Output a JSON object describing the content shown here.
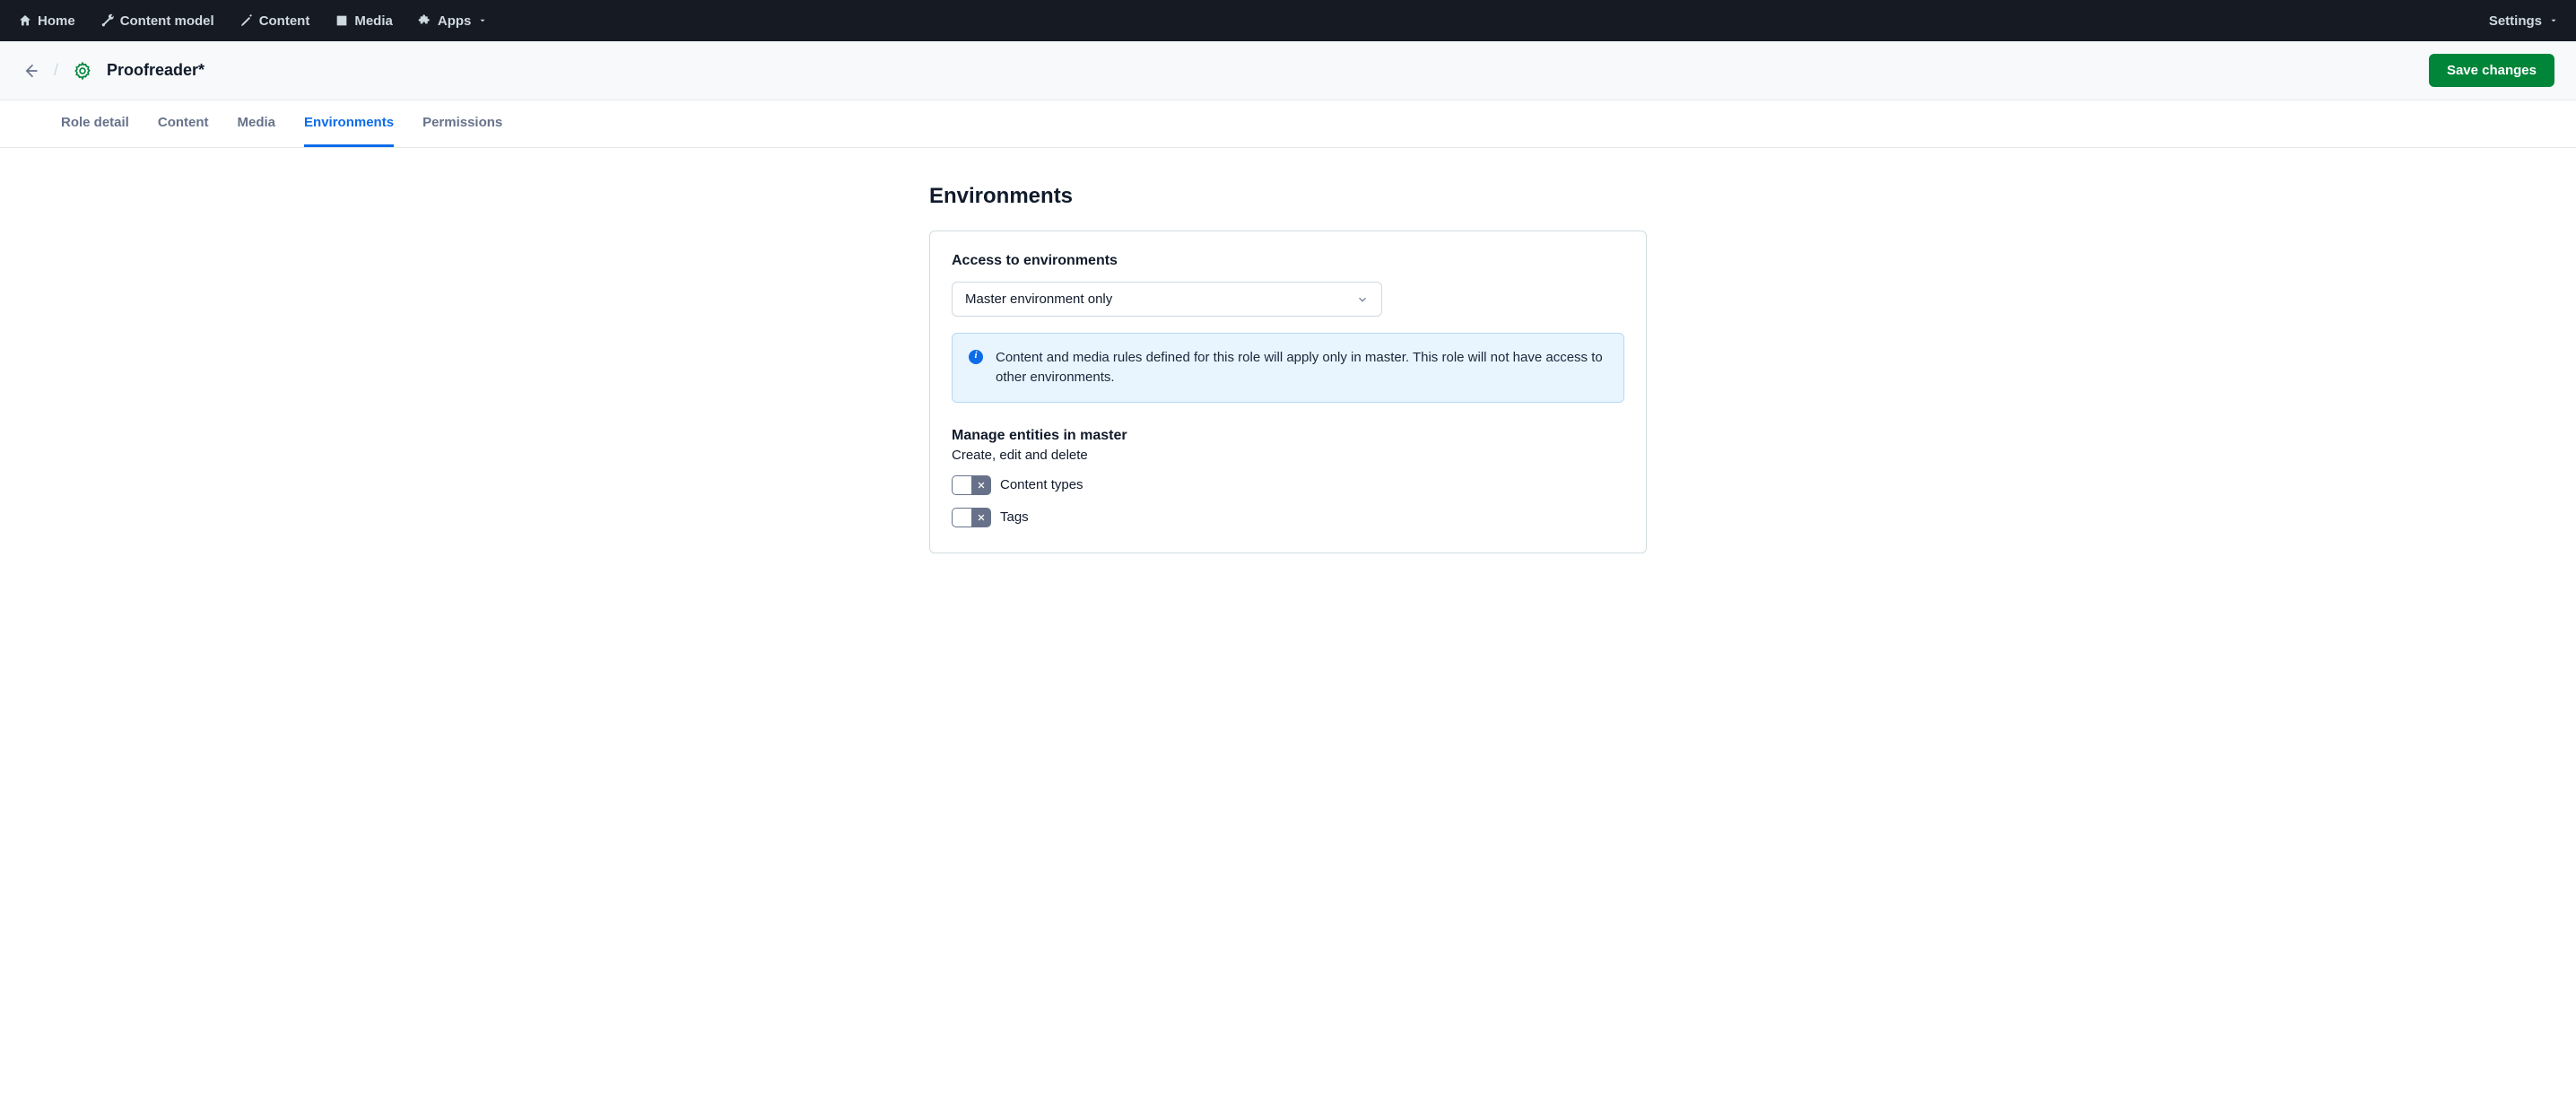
{
  "nav": {
    "items": [
      {
        "label": "Home"
      },
      {
        "label": "Content model"
      },
      {
        "label": "Content"
      },
      {
        "label": "Media"
      },
      {
        "label": "Apps"
      }
    ],
    "settings_label": "Settings"
  },
  "header": {
    "title": "Proofreader*",
    "save_label": "Save changes"
  },
  "tabs": [
    {
      "label": "Role detail",
      "active": false
    },
    {
      "label": "Content",
      "active": false
    },
    {
      "label": "Media",
      "active": false
    },
    {
      "label": "Environments",
      "active": true
    },
    {
      "label": "Permissions",
      "active": false
    }
  ],
  "main": {
    "heading": "Environments",
    "access_title": "Access to environments",
    "select_value": "Master environment only",
    "info_text": "Content and media rules defined for this role will apply only in master. This role will not have access to other environments.",
    "manage_title": "Manage entities in master",
    "manage_sub": "Create, edit and delete",
    "toggles": [
      {
        "label": "Content types"
      },
      {
        "label": "Tags"
      }
    ]
  }
}
